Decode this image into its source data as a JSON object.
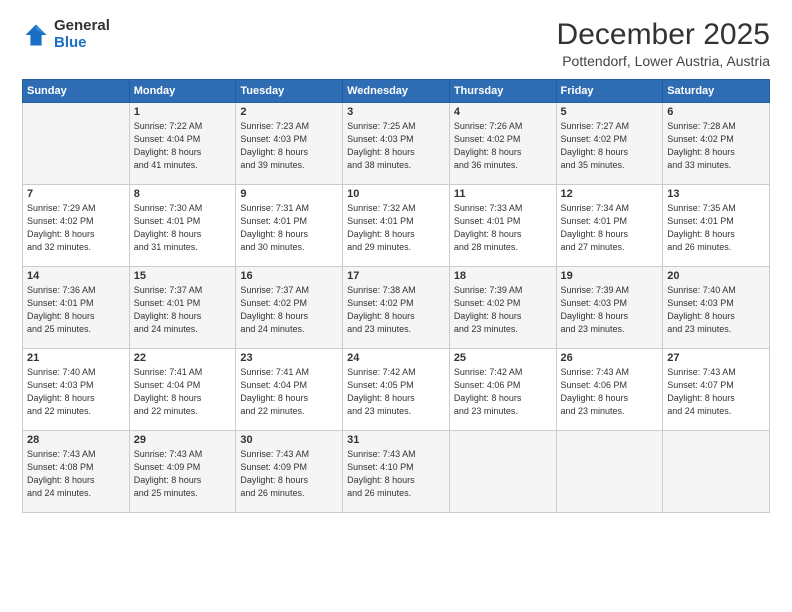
{
  "logo": {
    "general": "General",
    "blue": "Blue"
  },
  "title": "December 2025",
  "subtitle": "Pottendorf, Lower Austria, Austria",
  "weekdays": [
    "Sunday",
    "Monday",
    "Tuesday",
    "Wednesday",
    "Thursday",
    "Friday",
    "Saturday"
  ],
  "weeks": [
    [
      {
        "day": "",
        "info": ""
      },
      {
        "day": "1",
        "info": "Sunrise: 7:22 AM\nSunset: 4:04 PM\nDaylight: 8 hours\nand 41 minutes."
      },
      {
        "day": "2",
        "info": "Sunrise: 7:23 AM\nSunset: 4:03 PM\nDaylight: 8 hours\nand 39 minutes."
      },
      {
        "day": "3",
        "info": "Sunrise: 7:25 AM\nSunset: 4:03 PM\nDaylight: 8 hours\nand 38 minutes."
      },
      {
        "day": "4",
        "info": "Sunrise: 7:26 AM\nSunset: 4:02 PM\nDaylight: 8 hours\nand 36 minutes."
      },
      {
        "day": "5",
        "info": "Sunrise: 7:27 AM\nSunset: 4:02 PM\nDaylight: 8 hours\nand 35 minutes."
      },
      {
        "day": "6",
        "info": "Sunrise: 7:28 AM\nSunset: 4:02 PM\nDaylight: 8 hours\nand 33 minutes."
      }
    ],
    [
      {
        "day": "7",
        "info": "Sunrise: 7:29 AM\nSunset: 4:02 PM\nDaylight: 8 hours\nand 32 minutes."
      },
      {
        "day": "8",
        "info": "Sunrise: 7:30 AM\nSunset: 4:01 PM\nDaylight: 8 hours\nand 31 minutes."
      },
      {
        "day": "9",
        "info": "Sunrise: 7:31 AM\nSunset: 4:01 PM\nDaylight: 8 hours\nand 30 minutes."
      },
      {
        "day": "10",
        "info": "Sunrise: 7:32 AM\nSunset: 4:01 PM\nDaylight: 8 hours\nand 29 minutes."
      },
      {
        "day": "11",
        "info": "Sunrise: 7:33 AM\nSunset: 4:01 PM\nDaylight: 8 hours\nand 28 minutes."
      },
      {
        "day": "12",
        "info": "Sunrise: 7:34 AM\nSunset: 4:01 PM\nDaylight: 8 hours\nand 27 minutes."
      },
      {
        "day": "13",
        "info": "Sunrise: 7:35 AM\nSunset: 4:01 PM\nDaylight: 8 hours\nand 26 minutes."
      }
    ],
    [
      {
        "day": "14",
        "info": "Sunrise: 7:36 AM\nSunset: 4:01 PM\nDaylight: 8 hours\nand 25 minutes."
      },
      {
        "day": "15",
        "info": "Sunrise: 7:37 AM\nSunset: 4:01 PM\nDaylight: 8 hours\nand 24 minutes."
      },
      {
        "day": "16",
        "info": "Sunrise: 7:37 AM\nSunset: 4:02 PM\nDaylight: 8 hours\nand 24 minutes."
      },
      {
        "day": "17",
        "info": "Sunrise: 7:38 AM\nSunset: 4:02 PM\nDaylight: 8 hours\nand 23 minutes."
      },
      {
        "day": "18",
        "info": "Sunrise: 7:39 AM\nSunset: 4:02 PM\nDaylight: 8 hours\nand 23 minutes."
      },
      {
        "day": "19",
        "info": "Sunrise: 7:39 AM\nSunset: 4:03 PM\nDaylight: 8 hours\nand 23 minutes."
      },
      {
        "day": "20",
        "info": "Sunrise: 7:40 AM\nSunset: 4:03 PM\nDaylight: 8 hours\nand 23 minutes."
      }
    ],
    [
      {
        "day": "21",
        "info": "Sunrise: 7:40 AM\nSunset: 4:03 PM\nDaylight: 8 hours\nand 22 minutes."
      },
      {
        "day": "22",
        "info": "Sunrise: 7:41 AM\nSunset: 4:04 PM\nDaylight: 8 hours\nand 22 minutes."
      },
      {
        "day": "23",
        "info": "Sunrise: 7:41 AM\nSunset: 4:04 PM\nDaylight: 8 hours\nand 22 minutes."
      },
      {
        "day": "24",
        "info": "Sunrise: 7:42 AM\nSunset: 4:05 PM\nDaylight: 8 hours\nand 23 minutes."
      },
      {
        "day": "25",
        "info": "Sunrise: 7:42 AM\nSunset: 4:06 PM\nDaylight: 8 hours\nand 23 minutes."
      },
      {
        "day": "26",
        "info": "Sunrise: 7:43 AM\nSunset: 4:06 PM\nDaylight: 8 hours\nand 23 minutes."
      },
      {
        "day": "27",
        "info": "Sunrise: 7:43 AM\nSunset: 4:07 PM\nDaylight: 8 hours\nand 24 minutes."
      }
    ],
    [
      {
        "day": "28",
        "info": "Sunrise: 7:43 AM\nSunset: 4:08 PM\nDaylight: 8 hours\nand 24 minutes."
      },
      {
        "day": "29",
        "info": "Sunrise: 7:43 AM\nSunset: 4:09 PM\nDaylight: 8 hours\nand 25 minutes."
      },
      {
        "day": "30",
        "info": "Sunrise: 7:43 AM\nSunset: 4:09 PM\nDaylight: 8 hours\nand 26 minutes."
      },
      {
        "day": "31",
        "info": "Sunrise: 7:43 AM\nSunset: 4:10 PM\nDaylight: 8 hours\nand 26 minutes."
      },
      {
        "day": "",
        "info": ""
      },
      {
        "day": "",
        "info": ""
      },
      {
        "day": "",
        "info": ""
      }
    ]
  ]
}
